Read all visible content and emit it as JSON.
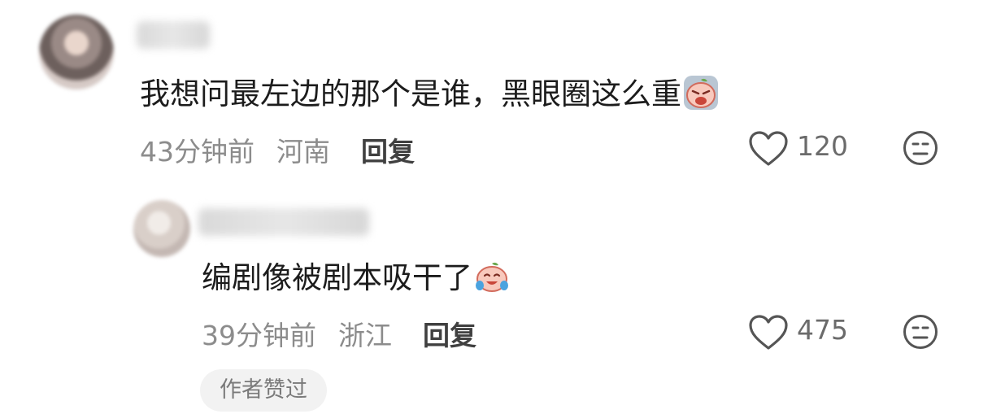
{
  "comment": {
    "text": "我想问最左边的那个是谁，黑眼圈这么重",
    "time": "43分钟前",
    "location": "河南",
    "reply_label": "回复",
    "like_count": "120",
    "emoji_icon": "crying-face-emoji"
  },
  "reply": {
    "text": "编剧像被剧本吸干了",
    "time": "39分钟前",
    "location": "浙江",
    "reply_label": "回复",
    "like_count": "475",
    "emoji_icon": "tears-of-joy-emoji",
    "author_badge": "作者赞过"
  }
}
